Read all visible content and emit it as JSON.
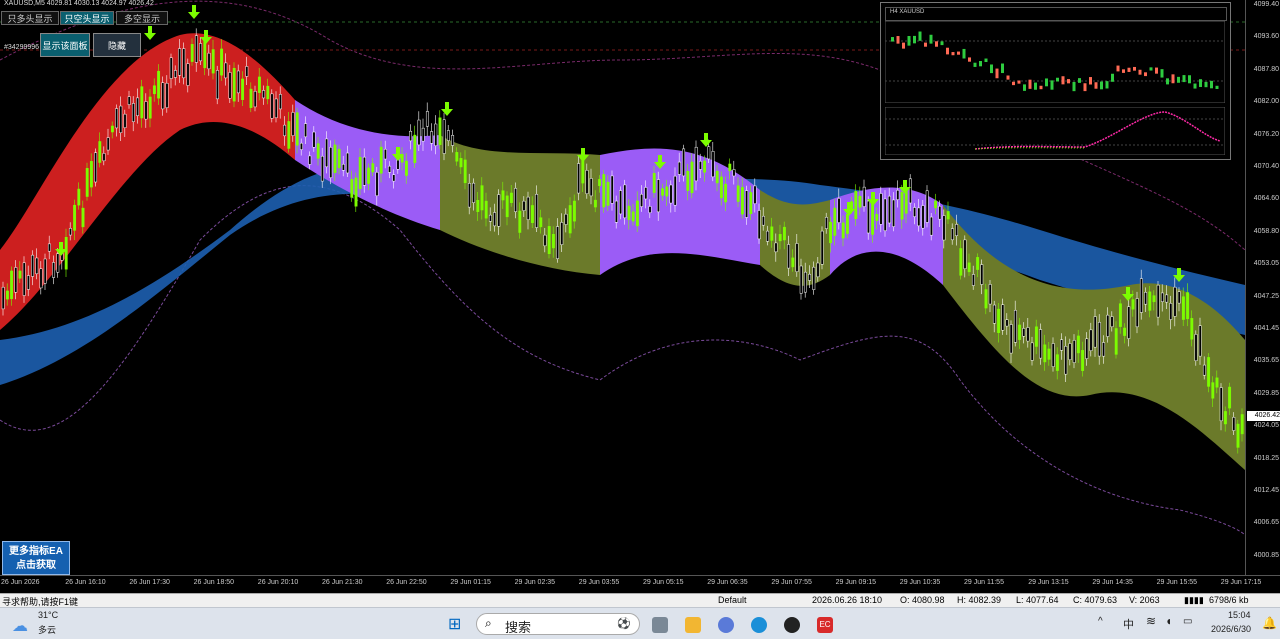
{
  "window": {
    "symbol_line": "XAUUSD,M5  4029.81 4030.13 4024.97 4026.42"
  },
  "top_buttons": [
    {
      "label": "只多头显示",
      "active": false
    },
    {
      "label": "只空头显示",
      "active": true
    },
    {
      "label": "多空显示",
      "active": false
    }
  ],
  "panel_buttons": {
    "show_panel": "显示该面板",
    "hide": "隐藏"
  },
  "account_line": "#34299996",
  "promo": {
    "line1": "更多指标EA",
    "line2": "点击获取"
  },
  "price_axis": [
    "4099.40",
    "4093.60",
    "4087.80",
    "4082.00",
    "4076.20",
    "4070.40",
    "4064.60",
    "4058.80",
    "4053.05",
    "4047.25",
    "4041.45",
    "4035.65",
    "4029.85",
    "4024.05",
    "4018.25",
    "4012.45",
    "4006.65",
    "4000.85"
  ],
  "current_price": "4026.42",
  "time_axis": [
    "26 Jun 2026",
    "26 Jun 16:10",
    "26 Jun 17:30",
    "26 Jun 18:50",
    "26 Jun 20:10",
    "26 Jun 21:30",
    "26 Jun 22:50",
    "29 Jun 01:15",
    "29 Jun 02:35",
    "29 Jun 03:55",
    "29 Jun 05:15",
    "29 Jun 06:35",
    "29 Jun 07:55",
    "29 Jun 09:15",
    "29 Jun 10:35",
    "29 Jun 11:55",
    "29 Jun 13:15",
    "29 Jun 14:35",
    "29 Jun 15:55",
    "29 Jun 17:15"
  ],
  "mini_chart": {
    "title": "H4 XAUUSD"
  },
  "status_bar": {
    "help": "寻求帮助,请按F1键",
    "profile": "Default",
    "datetime": "2026.06.26 18:10",
    "open": "O: 4080.98",
    "high": "H: 4082.39",
    "low": "L: 4077.64",
    "close": "C: 4079.63",
    "volume": "V: 2063",
    "traffic": "6798/6 kb"
  },
  "taskbar": {
    "weather_temp": "31°C",
    "weather_desc": "多云",
    "search_placeholder": "搜索",
    "ime": "中",
    "time": "15:04",
    "date": "2026/6/30",
    "ec_label": "EC"
  },
  "colors": {
    "bear_zone": "#cc1f1f",
    "bull_zone_violet": "#9b5cf6",
    "olive_zone": "#6b7a2a",
    "blue_band": "#1d5fb0",
    "arrow": "#7cfc00",
    "candle_bull": "#7cfc00",
    "candle_bear": "#ffffff",
    "envelope": "#7a2a6a"
  }
}
